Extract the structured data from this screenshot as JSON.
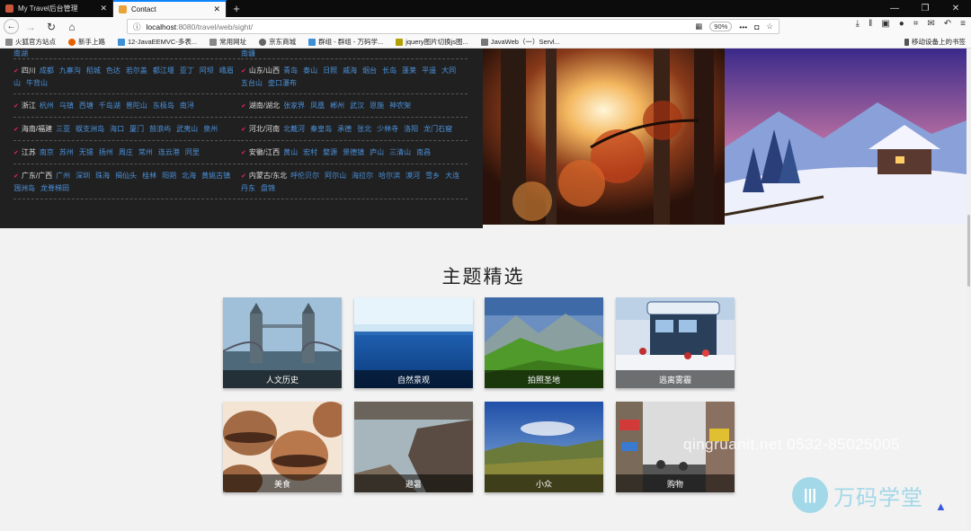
{
  "tabs": [
    {
      "title": "My Travel后台管理",
      "active": false,
      "icon_color": "#c8553d"
    },
    {
      "title": "Contact",
      "active": true,
      "icon_color": "#e8a33b"
    }
  ],
  "address_bar": {
    "host": "localhost",
    "path": ":8080/travel/web/sight/",
    "zoom": "90%"
  },
  "bookmarks": [
    {
      "label": "火狐官方站点",
      "icon_color": "#888"
    },
    {
      "label": "新手上路",
      "icon_color": "#e66000"
    },
    {
      "label": "12-JavaEEMVC-多表...",
      "icon_color": "#3d8fd6"
    },
    {
      "label": "常用网址",
      "icon_color": "#888"
    },
    {
      "label": "京东商城",
      "icon_color": "#666"
    },
    {
      "label": "群组 - 群组 - 万码学...",
      "icon_color": "#3d8fd6"
    },
    {
      "label": "jquery图片切换js图...",
      "icon_color": "#b0a000"
    },
    {
      "label": "JavaWeb（一）Servl...",
      "icon_color": "#777"
    }
  ],
  "bookmarks_right": "移动设备上的书签",
  "destinations": {
    "col1": {
      "top_link": "南湖",
      "rows": [
        {
          "head": "四川",
          "cities": [
            "成都",
            "九寨沟",
            "稻城",
            "色达",
            "若尔盖",
            "都江堰",
            "亚丁",
            "阿坝",
            "峨眉山",
            "牛背山"
          ]
        },
        {
          "head": "浙江",
          "cities": [
            "杭州",
            "乌镇",
            "西塘",
            "千岛湖",
            "普陀山",
            "东极岛",
            "南浔"
          ]
        },
        {
          "head": "海南/福建",
          "cities": [
            "三亚",
            "蜈支洲岛",
            "海口",
            "厦门",
            "鼓浪屿",
            "武夷山",
            "泉州"
          ]
        },
        {
          "head": "江苏",
          "cities": [
            "南京",
            "苏州",
            "无锡",
            "扬州",
            "周庄",
            "常州",
            "连云港",
            "同里"
          ]
        },
        {
          "head": "广东/广西",
          "cities": [
            "广州",
            "深圳",
            "珠海",
            "揭仙头",
            "桂林",
            "阳朔",
            "北海",
            "黄姚古镇",
            "涠洲岛",
            "龙脊梯田"
          ]
        }
      ]
    },
    "col2": {
      "top_link": "南疆",
      "rows": [
        {
          "head": "山东/山西",
          "cities": [
            "青岛",
            "泰山",
            "日照",
            "威海",
            "烟台",
            "长岛",
            "蓬莱",
            "平遥",
            "大同",
            "五台山",
            "壶口瀑布"
          ]
        },
        {
          "head": "湖南/湖北",
          "cities": [
            "张家界",
            "凤凰",
            "郴州",
            "武汉",
            "恩施",
            "神农架"
          ]
        },
        {
          "head": "河北/河南",
          "cities": [
            "北戴河",
            "秦皇岛",
            "承德",
            "张北",
            "少林寺",
            "洛阳",
            "龙门石窟"
          ]
        },
        {
          "head": "安徽/江西",
          "cities": [
            "黄山",
            "宏村",
            "婺源",
            "景德镇",
            "庐山",
            "三清山",
            "南昌"
          ]
        },
        {
          "head": "内蒙古/东北",
          "cities": [
            "呼伦贝尔",
            "阿尔山",
            "海拉尔",
            "哈尔滨",
            "漠河",
            "雪乡",
            "大连",
            "丹东",
            "盘锦"
          ]
        }
      ]
    }
  },
  "theme_section": {
    "title": "主题精选",
    "cards": [
      {
        "label": "人文历史",
        "scene": "bridge"
      },
      {
        "label": "自然景观",
        "scene": "sea"
      },
      {
        "label": "拍照圣地",
        "scene": "mountain"
      },
      {
        "label": "逃离雾霾",
        "scene": "ski"
      },
      {
        "label": "美食",
        "scene": "macaron"
      },
      {
        "label": "避暑",
        "scene": "lake"
      },
      {
        "label": "小众",
        "scene": "plain"
      },
      {
        "label": "购物",
        "scene": "street"
      }
    ]
  },
  "watermark": "qingruanit.net 0532-85025005",
  "logo_text": "万码学堂"
}
